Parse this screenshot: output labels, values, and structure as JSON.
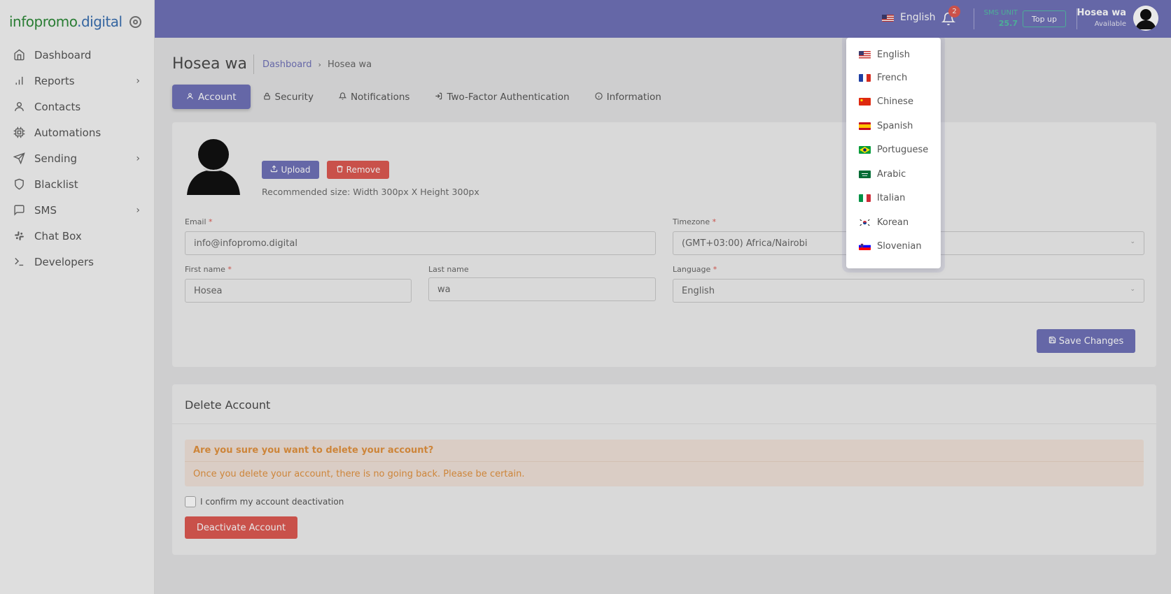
{
  "sidebar": {
    "logo_part1": "infopromo",
    "logo_part2": ".digital",
    "items": [
      {
        "label": "Dashboard",
        "icon": "home-icon",
        "has_submenu": false
      },
      {
        "label": "Reports",
        "icon": "bar-chart-icon",
        "has_submenu": true
      },
      {
        "label": "Contacts",
        "icon": "user-icon",
        "has_submenu": false
      },
      {
        "label": "Automations",
        "icon": "cpu-icon",
        "has_submenu": false
      },
      {
        "label": "Sending",
        "icon": "send-icon",
        "has_submenu": true
      },
      {
        "label": "Blacklist",
        "icon": "shield-icon",
        "has_submenu": false
      },
      {
        "label": "SMS",
        "icon": "message-icon",
        "has_submenu": true
      },
      {
        "label": "Chat Box",
        "icon": "slack-icon",
        "has_submenu": false
      },
      {
        "label": "Developers",
        "icon": "terminal-icon",
        "has_submenu": false
      }
    ]
  },
  "topbar": {
    "language": "English",
    "notification_count": "2",
    "sms_unit_label": "SMS UNIT",
    "sms_unit_value": "25.7",
    "topup_label": "Top up",
    "user_name": "Hosea wa",
    "user_status": "Available"
  },
  "page": {
    "title": "Hosea wa",
    "breadcrumb_home": "Dashboard",
    "breadcrumb_current": "Hosea wa"
  },
  "tabs": [
    {
      "label": "Account",
      "icon": "user-icon",
      "active": true
    },
    {
      "label": "Security",
      "icon": "lock-icon",
      "active": false
    },
    {
      "label": "Notifications",
      "icon": "bell-icon",
      "active": false
    },
    {
      "label": "Two-Factor Authentication",
      "icon": "log-in-icon",
      "active": false
    },
    {
      "label": "Information",
      "icon": "info-icon",
      "active": false
    }
  ],
  "account": {
    "upload_label": "Upload",
    "remove_label": "Remove",
    "recommended_size": "Recommended size: Width 300px X Height 300px",
    "email_label": "Email",
    "email_value": "info@infopromo.digital",
    "timezone_label": "Timezone",
    "timezone_value": "(GMT+03:00) Africa/Nairobi",
    "first_name_label": "First name",
    "first_name_value": "Hosea",
    "last_name_label": "Last name",
    "last_name_value": "wa",
    "language_label": "Language",
    "language_value": "English",
    "save_label": "Save Changes"
  },
  "delete_account": {
    "title": "Delete Account",
    "alert_title": "Are you sure you want to delete your account?",
    "alert_body": "Once you delete your account, there is no going back. Please be certain.",
    "confirm_label": "I confirm my account deactivation",
    "deactivate_label": "Deactivate Account"
  },
  "language_dropdown": [
    {
      "label": "English",
      "flag": "us"
    },
    {
      "label": "French",
      "flag": "fr"
    },
    {
      "label": "Chinese",
      "flag": "cn"
    },
    {
      "label": "Spanish",
      "flag": "es"
    },
    {
      "label": "Portuguese",
      "flag": "br"
    },
    {
      "label": "Arabic",
      "flag": "sa"
    },
    {
      "label": "Italian",
      "flag": "it"
    },
    {
      "label": "Korean",
      "flag": "kr"
    },
    {
      "label": "Slovenian",
      "flag": "si"
    }
  ],
  "colors": {
    "primary": "#7072b8",
    "danger": "#dd5a52",
    "warning_text": "#e29340",
    "sms_accent": "#54c0a6"
  }
}
